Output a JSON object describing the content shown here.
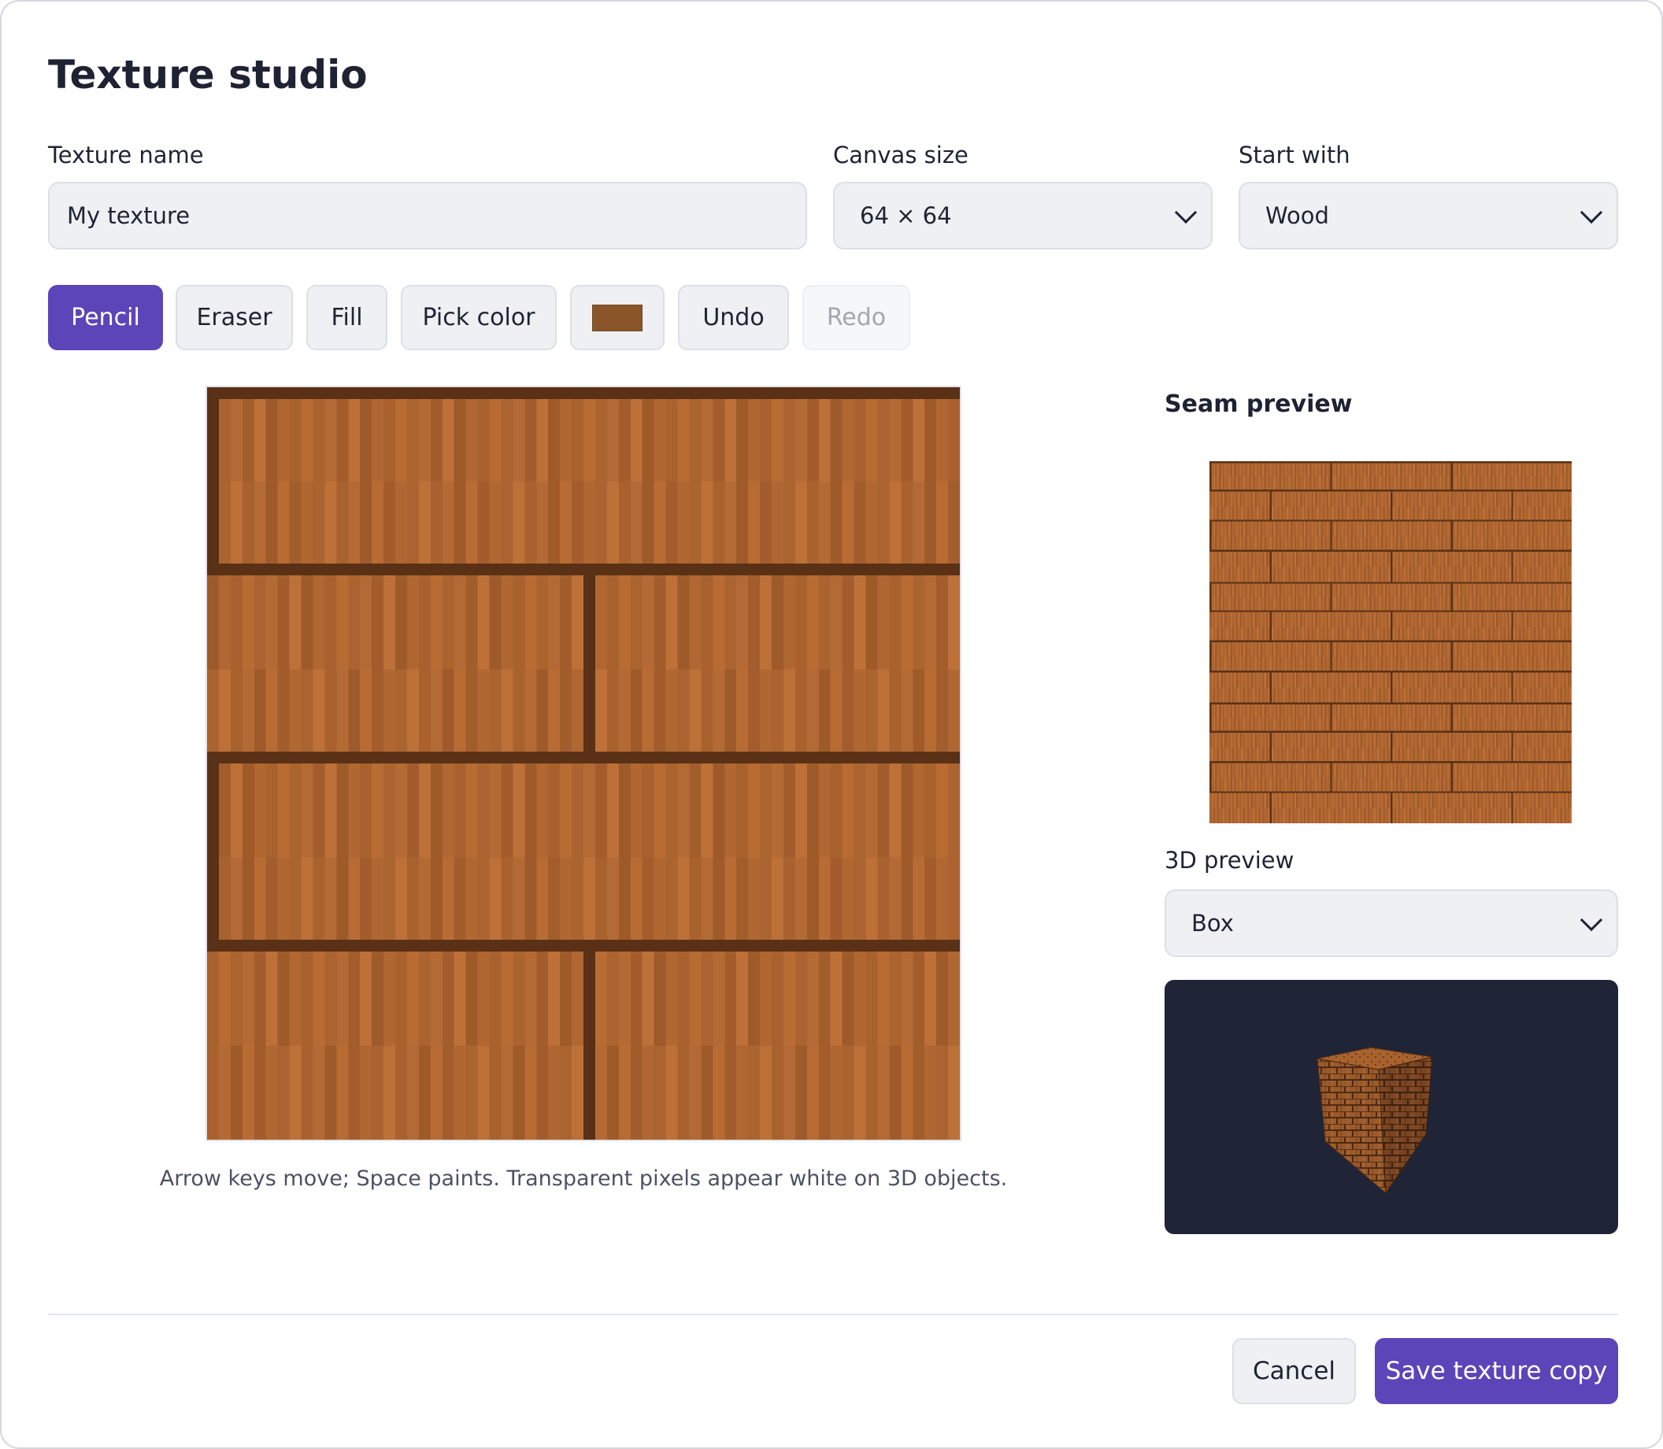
{
  "dialog": {
    "title": "Texture studio"
  },
  "fields": {
    "name_label": "Texture name",
    "name_value": "My texture",
    "size_label": "Canvas size",
    "size_value": "64 × 64",
    "start_label": "Start with",
    "start_value": "Wood"
  },
  "toolbar": {
    "pencil": "Pencil",
    "eraser": "Eraser",
    "fill": "Fill",
    "pick": "Pick color",
    "undo": "Undo",
    "redo": "Redo",
    "current_color": "#8a5528",
    "active_tool": "Pencil",
    "redo_disabled": true
  },
  "editor": {
    "hint": "Arrow keys move; Space paints. Transparent pixels appear white on 3D objects.",
    "pattern": "wood-planks"
  },
  "preview": {
    "seam_title": "Seam preview",
    "three_d_label": "3D preview",
    "shape_value": "Box",
    "object_shape": "cube"
  },
  "footer": {
    "cancel": "Cancel",
    "save": "Save texture copy"
  },
  "colors": {
    "accent": "#5b45b8",
    "wood_light": "#b86c34",
    "wood_dark": "#5a3116",
    "viewport_bg": "#1f2436"
  }
}
